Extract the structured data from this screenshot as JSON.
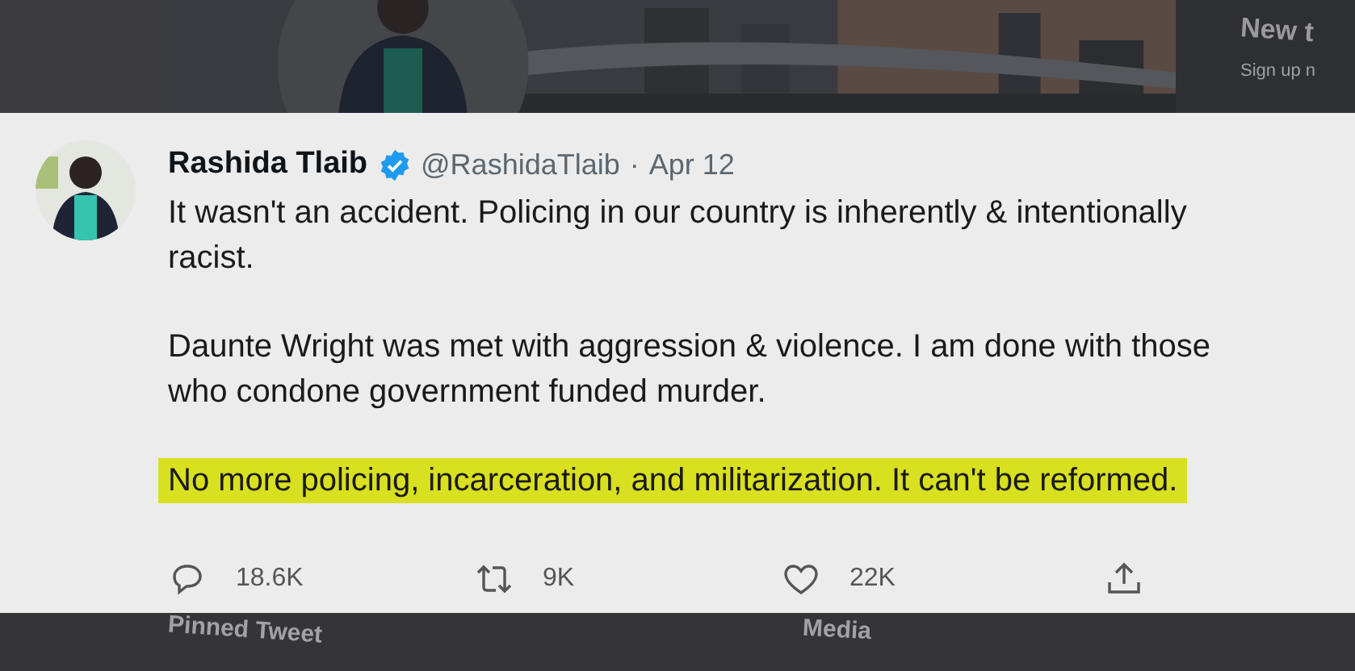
{
  "background_top": {
    "side_panel": {
      "title": "New t",
      "subtitle": "Sign up n"
    }
  },
  "tweet": {
    "author": {
      "name": "Rashida Tlaib",
      "verified": true,
      "handle": "@RashidaTlaib",
      "separator": "·",
      "date": "Apr 12"
    },
    "paragraphs": [
      {
        "text": "It wasn't an accident. Policing in our country is inherently & intentionally racist.",
        "highlighted": false
      },
      {
        "text": "Daunte Wright was met with aggression & violence. I am done with those who condone government funded murder.",
        "highlighted": false
      },
      {
        "text": "No more policing, incarceration, and militarization. It can't be reformed.",
        "highlighted": true
      }
    ],
    "actions": [
      {
        "kind": "reply",
        "count": "18.6K"
      },
      {
        "kind": "retweet",
        "count": "9K"
      },
      {
        "kind": "like",
        "count": "22K"
      },
      {
        "kind": "share"
      }
    ]
  },
  "background_bottom": {
    "tabs": [
      "Pinned Tweet",
      "Media"
    ]
  }
}
